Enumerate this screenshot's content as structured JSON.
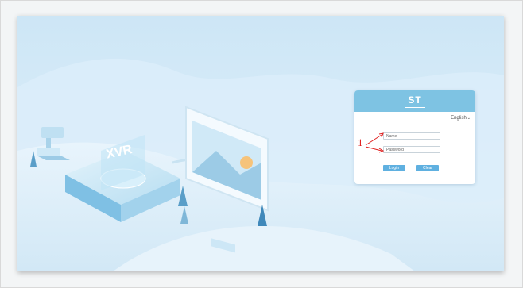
{
  "brand": {
    "logo_text": "ST"
  },
  "device": {
    "label": "XVR"
  },
  "login": {
    "language_label": "English",
    "username_placeholder": "Name",
    "password_placeholder": "Password",
    "login_button": "Login",
    "clear_button": "Clear"
  },
  "annotation": {
    "number": "1"
  },
  "colors": {
    "header": "#7ec3e3",
    "button": "#5fb0e0",
    "background": "#d8ecf8",
    "annotation": "#e02020"
  }
}
